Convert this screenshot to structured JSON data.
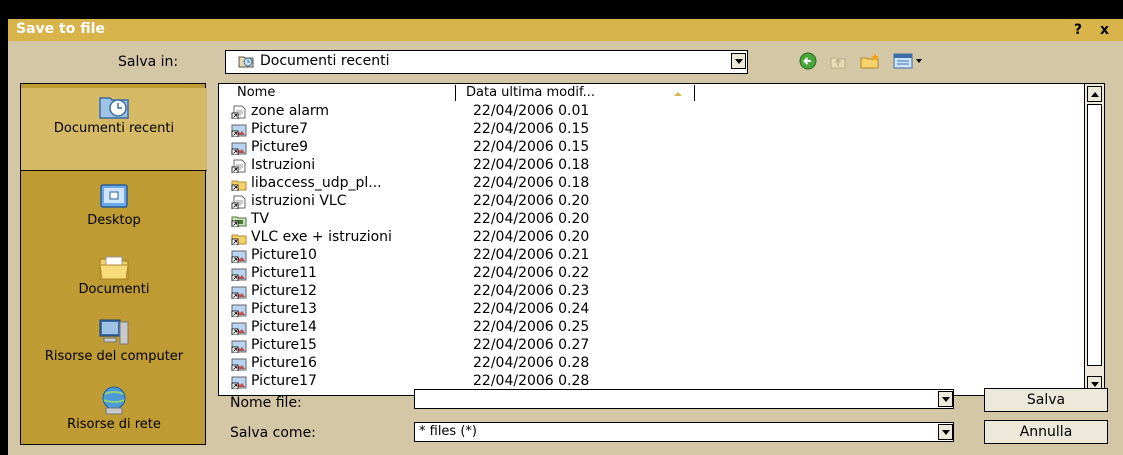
{
  "window": {
    "title": "Save to file",
    "help_label": "?",
    "close_label": "x"
  },
  "location": {
    "label": "Salva in:",
    "value": "Documenti recenti",
    "icon": "recent-docs-icon"
  },
  "toolbar": {
    "back_icon": "back-arrow-icon",
    "up_icon": "folder-up-icon",
    "new_folder_icon": "new-folder-icon",
    "views_icon": "view-menu-icon"
  },
  "places": [
    {
      "label": "Documenti recenti",
      "icon": "recent-docs-icon",
      "selected": true
    },
    {
      "label": "Desktop",
      "icon": "desktop-icon"
    },
    {
      "label": "Documenti",
      "icon": "documents-folder-icon"
    },
    {
      "label": "Risorse del computer",
      "icon": "computer-icon"
    },
    {
      "label": "Risorse di rete",
      "icon": "network-icon"
    }
  ],
  "filelist": {
    "columns": [
      "Nome",
      "Data ultima modif..."
    ],
    "rows": [
      {
        "name": "zone alarm",
        "date": "22/04/2006 0.01",
        "type": "shortcut-doc"
      },
      {
        "name": "Picture7",
        "date": "22/04/2006 0.15",
        "type": "shortcut-image"
      },
      {
        "name": "Picture9",
        "date": "22/04/2006 0.15",
        "type": "shortcut-image"
      },
      {
        "name": "Istruzioni",
        "date": "22/04/2006 0.18",
        "type": "shortcut-doc"
      },
      {
        "name": "libaccess_udp_pl...",
        "date": "22/04/2006 0.18",
        "type": "shortcut-folder"
      },
      {
        "name": "istruzioni VLC",
        "date": "22/04/2006 0.20",
        "type": "shortcut-doc"
      },
      {
        "name": "TV",
        "date": "22/04/2006 0.20",
        "type": "shortcut-tv"
      },
      {
        "name": "VLC exe + istruzioni",
        "date": "22/04/2006 0.20",
        "type": "shortcut-folder"
      },
      {
        "name": "Picture10",
        "date": "22/04/2006 0.21",
        "type": "shortcut-image"
      },
      {
        "name": "Picture11",
        "date": "22/04/2006 0.22",
        "type": "shortcut-image"
      },
      {
        "name": "Picture12",
        "date": "22/04/2006 0.23",
        "type": "shortcut-image"
      },
      {
        "name": "Picture13",
        "date": "22/04/2006 0.24",
        "type": "shortcut-image"
      },
      {
        "name": "Picture14",
        "date": "22/04/2006 0.25",
        "type": "shortcut-image"
      },
      {
        "name": "Picture15",
        "date": "22/04/2006 0.27",
        "type": "shortcut-image"
      },
      {
        "name": "Picture16",
        "date": "22/04/2006 0.28",
        "type": "shortcut-image"
      },
      {
        "name": "Picture17",
        "date": "22/04/2006 0.28",
        "type": "shortcut-image"
      }
    ]
  },
  "form": {
    "filename_label": "Nome file:",
    "filename_value": "",
    "filetype_label": "Salva come:",
    "filetype_value": "* files (*)"
  },
  "buttons": {
    "save": "Salva",
    "cancel": "Annulla"
  }
}
